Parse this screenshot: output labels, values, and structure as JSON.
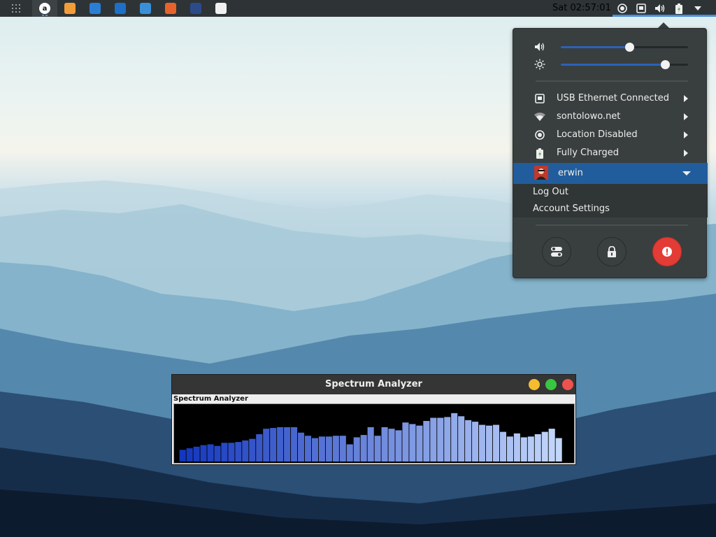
{
  "topbar": {
    "clock": "Sat 02:57:01",
    "dock_apps": [
      {
        "name": "Amazon",
        "color": "#ffffff",
        "glyph": "a",
        "active": true
      },
      {
        "name": "Files",
        "color": "#f39c3a",
        "glyph": "",
        "active": false
      },
      {
        "name": "Screenshot",
        "color": "#2a7fd4",
        "glyph": "",
        "active": false
      },
      {
        "name": "Software",
        "color": "#1e6fc8",
        "glyph": "",
        "active": false
      },
      {
        "name": "Browser",
        "color": "#3a8fd8",
        "glyph": "",
        "active": false
      },
      {
        "name": "Firefox",
        "color": "#e8632b",
        "glyph": "",
        "active": false
      },
      {
        "name": "Settings",
        "color": "#2d4b8a",
        "glyph": "",
        "active": false
      },
      {
        "name": "Color Picker",
        "color": "#f0f0f0",
        "glyph": "",
        "active": false
      }
    ]
  },
  "system_menu": {
    "volume_level": 0.54,
    "brightness_level": 0.82,
    "items": [
      {
        "label": "USB Ethernet Connected",
        "icon": "ethernet-icon"
      },
      {
        "label": "sontolowo.net",
        "icon": "wifi-icon"
      },
      {
        "label": "Location Disabled",
        "icon": "location-icon"
      },
      {
        "label": "Fully Charged",
        "icon": "battery-icon"
      }
    ],
    "user": {
      "name": "erwin",
      "submenu": [
        "Log Out",
        "Account Settings"
      ]
    },
    "actions": [
      "settings-icon",
      "lock-icon",
      "power-icon"
    ]
  },
  "spectrum_window": {
    "title": "Spectrum Analyzer",
    "inner_label": "Spectrum Analyzer",
    "bar_values": [
      15,
      17,
      19,
      21,
      22,
      20,
      24,
      24,
      25,
      27,
      29,
      35,
      42,
      43,
      44,
      44,
      44,
      37,
      33,
      30,
      32,
      32,
      33,
      33,
      22,
      31,
      34,
      44,
      33,
      44,
      42,
      40,
      50,
      48,
      46,
      52,
      56,
      56,
      57,
      62,
      58,
      53,
      51,
      47,
      46,
      47,
      38,
      32,
      36,
      31,
      32,
      35,
      38,
      42,
      30
    ]
  }
}
